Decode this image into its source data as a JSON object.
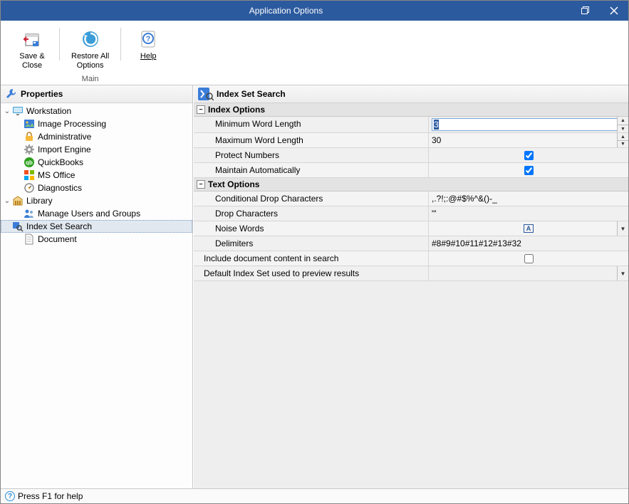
{
  "window": {
    "title": "Application Options"
  },
  "ribbon": {
    "save_close": "Save &\nClose",
    "restore_all": "Restore All\nOptions",
    "help": "Help",
    "group_main": "Main"
  },
  "sidebar": {
    "header": "Properties",
    "tree": {
      "workstation": "Workstation",
      "image_processing": "Image Processing",
      "administrative": "Administrative",
      "import_engine": "Import Engine",
      "quickbooks": "QuickBooks",
      "ms_office": "MS Office",
      "diagnostics": "Diagnostics",
      "library": "Library",
      "manage_users": "Manage Users and Groups",
      "index_set_search": "Index Set Search",
      "document": "Document"
    }
  },
  "main": {
    "header": "Index Set Search",
    "sections": {
      "index_options": "Index Options",
      "text_options": "Text Options"
    },
    "rows": {
      "min_word_length": {
        "label": "Minimum Word Length",
        "value": "3"
      },
      "max_word_length": {
        "label": "Maximum Word Length",
        "value": "30"
      },
      "protect_numbers": {
        "label": "Protect Numbers",
        "checked": true
      },
      "maintain_auto": {
        "label": "Maintain Automatically",
        "checked": true
      },
      "cond_drop": {
        "label": "Conditional Drop Characters",
        "value": ",.?!;:@#$%^&()-_"
      },
      "drop_chars": {
        "label": "Drop Characters",
        "value": "\"'"
      },
      "noise_words": {
        "label": "Noise Words",
        "badge": "A"
      },
      "delimiters": {
        "label": "Delimiters",
        "value": "#8#9#10#11#12#13#32"
      },
      "include_doc": {
        "label": "Include document content in search",
        "checked": false
      },
      "default_set": {
        "label": "Default Index Set used to preview results",
        "value": ""
      }
    }
  },
  "status": {
    "text": "Press F1 for help"
  }
}
